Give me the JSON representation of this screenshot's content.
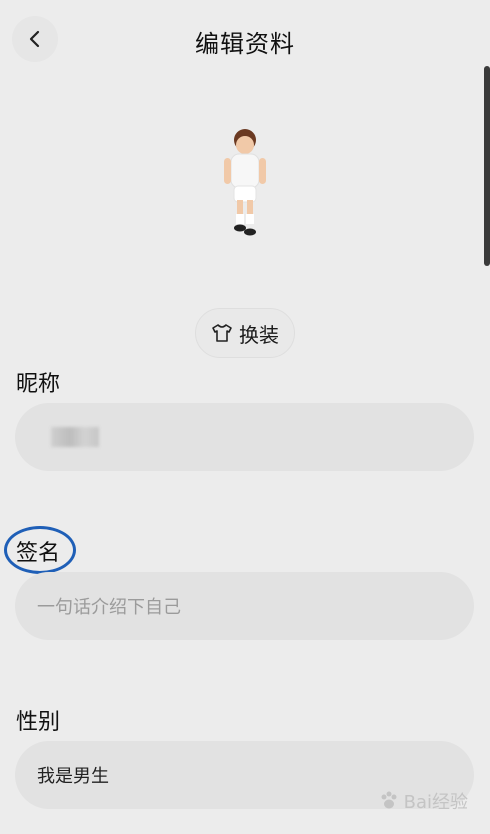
{
  "header": {
    "title": "编辑资料"
  },
  "outfit": {
    "label": "换装"
  },
  "fields": {
    "nickname": {
      "label": "昵称"
    },
    "signature": {
      "label": "签名",
      "placeholder": "一句话介绍下自己"
    },
    "gender": {
      "label": "性别",
      "value": "我是男生"
    }
  },
  "watermark": {
    "text": "Bai经验"
  },
  "colors": {
    "background": "#ececec",
    "field": "#e2e2e2",
    "annotation_circle": "#1f5fb7"
  }
}
